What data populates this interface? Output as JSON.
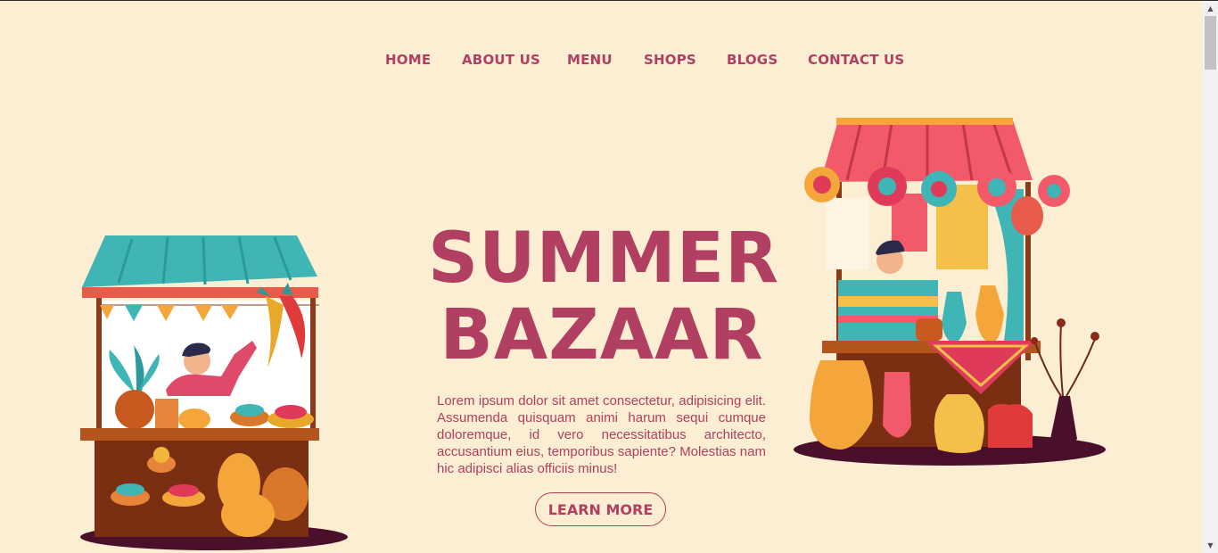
{
  "nav": {
    "items": [
      "HOME",
      "ABOUT US",
      "MENU",
      "SHOPS",
      "BLOGS",
      "CONTACT US"
    ]
  },
  "hero": {
    "title_line1": "SUMMER",
    "title_line2": "BAZAAR",
    "description": "Lorem ipsum dolor sit amet consectetur, adipisicing elit. Assumenda quisquam animi harum sequi cumque doloremque, id vero necessitatibus architecto, accusantium eius, temporibus sapiente? Molestias nam hic adipisci alias officiis minus!",
    "button_label": "LEARN MORE"
  },
  "colors": {
    "background": "#fbeed2",
    "accent": "#b13f61"
  },
  "icons": {
    "scroll_up": "scroll-up-arrow-icon",
    "scroll_down": "scroll-down-arrow-icon"
  }
}
